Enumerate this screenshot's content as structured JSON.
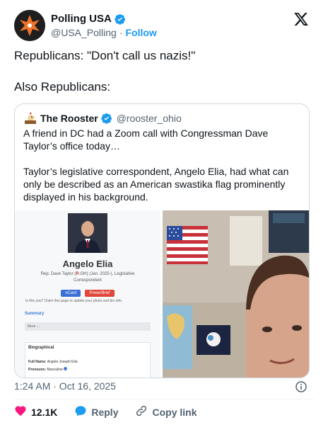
{
  "author": {
    "name": "Polling USA",
    "handle": "@USA_Polling",
    "separator": "·",
    "follow_label": "Follow"
  },
  "tweet": {
    "line1": "Republicans: \"Don't call us nazis!\"",
    "line2": "Also Republicans:"
  },
  "quote": {
    "name": "The Rooster",
    "handle": "@rooster_ohio",
    "text1": "A friend in DC had a Zoom call with Congressman Dave Taylor’s office today…",
    "text2": "Taylor’s legislative correspondent, Angelo Elia, had what can only be described as an American swastika flag prominently displayed in his background."
  },
  "profile_card": {
    "name": "Angelo Elia",
    "role_prefix": "Rep. Dave Taylor (",
    "party": "R",
    "role_suffix": "-OH) (Jan. 2025-), Legislative Correspondent",
    "vcard_label": "vCard",
    "powerbrief_label": "PowerBrief",
    "claim_text": "Is this you? Claim this page to update your photo and bio info.",
    "summary_label": "Summary",
    "more_label": "More ...",
    "bio_title": "Biographical",
    "full_name_label": "Full Name:",
    "full_name": "Angelo Joseph Elia",
    "pronouns_label": "Pronouns:",
    "pronouns": "Masculine"
  },
  "meta": {
    "timestamp": "1:24 AM · Oct 16, 2025"
  },
  "actions": {
    "likes": "12.1K",
    "reply_label": "Reply",
    "copy_link_label": "Copy link"
  },
  "colors": {
    "accent": "#1d9bf0",
    "like": "#f91880",
    "text": "#0f1419",
    "muted": "#536471"
  }
}
